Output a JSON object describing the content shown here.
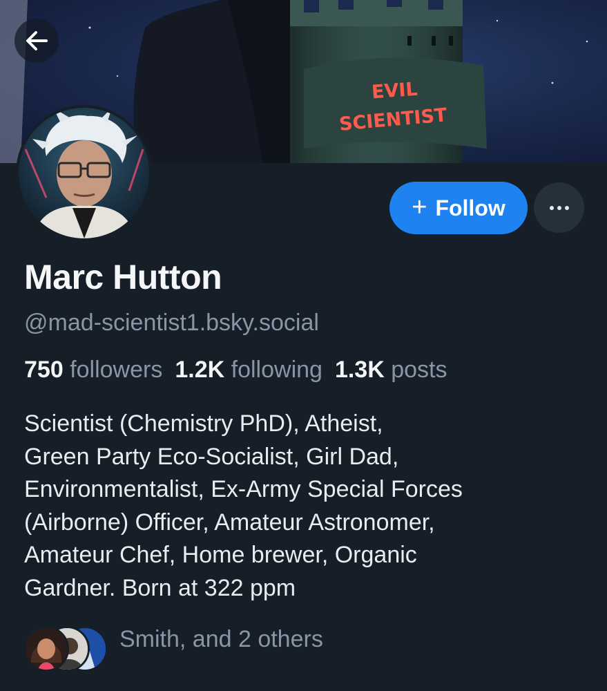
{
  "banner": {
    "sign_line1": "EVIL",
    "sign_line2": "SCIENTIST"
  },
  "header": {
    "back_icon": "arrow-left-icon"
  },
  "actions": {
    "follow_label": "Follow",
    "follow_icon": "plus-icon",
    "more_icon": "ellipsis-icon",
    "accent": "#1e83f0"
  },
  "profile": {
    "display_name": "Marc Hutton",
    "handle": "@mad-scientist1.bsky.social",
    "stats": {
      "followers_count": "750",
      "followers_label": "followers",
      "following_count": "1.2K",
      "following_label": "following",
      "posts_count": "1.3K",
      "posts_label": "posts"
    },
    "bio_lines": [
      "Scientist (Chemistry PhD), Atheist,",
      "Green Party Eco-Socialist, Girl Dad,",
      "Environmentalist, Ex-Army Special Forces",
      "(Airborne) Officer, Amateur Astronomer,",
      "Amateur Chef, Home brewer, Organic",
      "Gardner. Born at 322 ppm"
    ]
  },
  "known_followers": {
    "text": "Smith, and 2 others"
  }
}
